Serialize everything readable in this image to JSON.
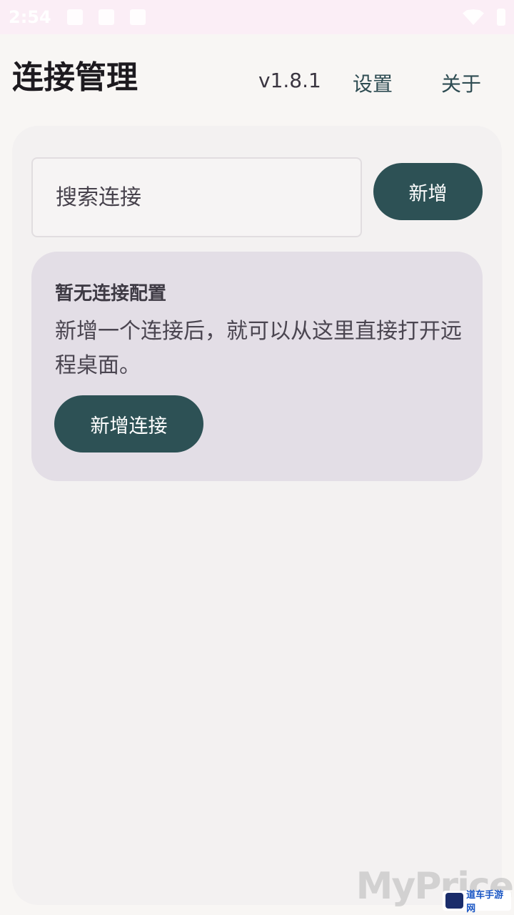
{
  "status_bar": {
    "time": "2:54",
    "icons": [
      "notification-icon",
      "download-icon",
      "sim-icon"
    ],
    "right_icons": [
      "wifi-icon",
      "battery-icon"
    ]
  },
  "header": {
    "title": "连接管理",
    "version": "v1.8.1",
    "settings_label": "设置",
    "about_label": "关于"
  },
  "search": {
    "placeholder": "搜索连接"
  },
  "toolbar": {
    "add_label": "新增"
  },
  "empty_state": {
    "title": "暂无连接配置",
    "description": "新增一个连接后，就可以从这里直接打开远程桌面。",
    "button_label": "新增连接"
  },
  "watermark": {
    "text": "MyPrice",
    "badge": "道车手游网"
  },
  "colors": {
    "accent": "#2d5155",
    "card_bg": "#e3dee6",
    "panel_bg": "#f3f1f1"
  }
}
